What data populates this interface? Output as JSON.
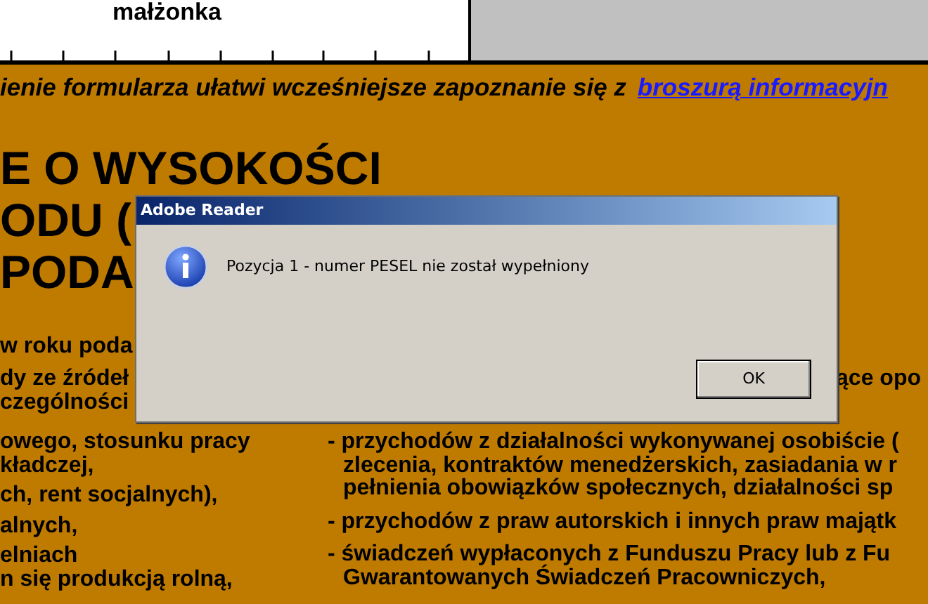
{
  "form": {
    "header_field": {
      "label": "małżonka"
    },
    "notice": {
      "text": "ienie formularza ułatwi wcześniejsze zapoznanie się z",
      "link": "broszurą informacyjn"
    },
    "headings": [
      "E O WYSOKOŚCI",
      "ODU (",
      "PODA"
    ],
    "intro_lines": [
      "w roku poda",
      "dy ze źródeł",
      "czególności"
    ],
    "side_text": "ące opo",
    "left_column": [
      {
        "lines": [
          "owego, stosunku pracy",
          "kładczej,"
        ]
      },
      {
        "lines": [
          "ch, rent socjalnych),"
        ]
      },
      {
        "lines": [
          "alnych,"
        ]
      },
      {
        "lines": [
          "elniach",
          "n się produkcją rolną,"
        ]
      }
    ],
    "right_column": [
      {
        "lines": [
          "- przychodów z działalności wykonywanej osobiście (",
          "zlecenia, kontraktów menedżerskich, zasiadania w r",
          "pełnienia obowiązków społecznych, działalności sp"
        ]
      },
      {
        "lines": [
          "- przychodów z praw autorskich i innych praw majątk"
        ]
      },
      {
        "lines": [
          "- świadczeń wypłaconych z Funduszu Pracy lub z Fu",
          "Gwarantowanych Świadczeń Pracowniczych,"
        ]
      }
    ]
  },
  "dialog": {
    "title": "Adobe Reader",
    "message": "Pozycja 1 - numer PESEL nie został wypełniony",
    "buttons": [
      "OK"
    ]
  }
}
